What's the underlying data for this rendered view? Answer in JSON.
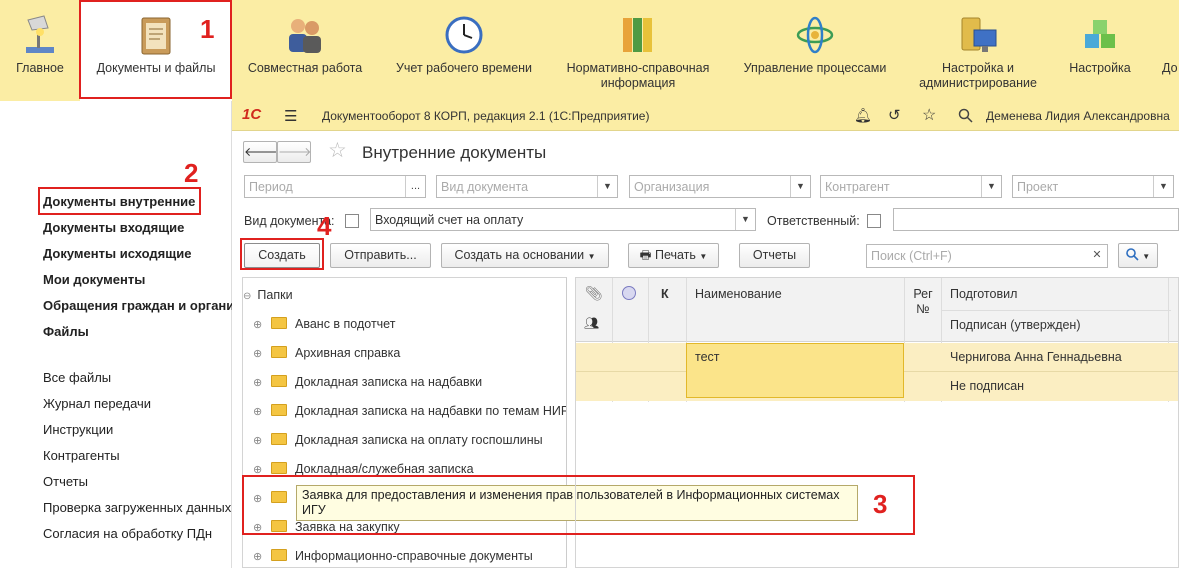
{
  "sections": [
    {
      "label": "Главное",
      "icon": "home-lamp-icon"
    },
    {
      "label": "Документы и файлы",
      "icon": "documents-binder-icon"
    },
    {
      "label": "Совместная работа",
      "icon": "users-collaboration-icon"
    },
    {
      "label": "Учет рабочего времени",
      "icon": "clock-icon"
    },
    {
      "label": "Нормативно-справочная информация",
      "icon": "reference-binders-icon"
    },
    {
      "label": "Управление процессами",
      "icon": "process-atom-icon"
    },
    {
      "label": "Настройка и администрирование",
      "icon": "server-computer-icon"
    },
    {
      "label": "Настройка",
      "icon": "cubes-icon"
    },
    {
      "label": "До",
      "icon": ""
    }
  ],
  "sidebar": {
    "group1": [
      "Документы внутренние",
      "Документы входящие",
      "Документы исходящие",
      "Мои документы",
      "Обращения граждан и организаций",
      "Файлы"
    ],
    "group2": [
      "Все файлы",
      "Журнал передачи",
      "Инструкции",
      "Контрагенты",
      "Отчеты",
      "Проверка загруженных данных",
      "Согласия на обработку ПДн"
    ]
  },
  "window": {
    "logo": "1С",
    "title": "Документооборот 8 КОРП, редакция 2.1  (1С:Предприятие)",
    "user": "Деменева Лидия Александровна",
    "form_title": "Внутренние документы"
  },
  "filters": {
    "period": "Период",
    "doc_kind": "Вид документа",
    "organization": "Организация",
    "counterparty": "Контрагент",
    "project": "Проект",
    "doc_kind_label": "Вид документа:",
    "doc_kind_value": "Входящий счет на оплату",
    "responsible_label": "Ответственный:"
  },
  "toolbar": {
    "create": "Создать",
    "send": "Отправить...",
    "create_based": "Создать на основании",
    "print": "Печать",
    "reports": "Отчеты",
    "search_placeholder": "Поиск (Ctrl+F)"
  },
  "folders": {
    "root": "Папки",
    "items": [
      "Аванс в подотчет",
      "Архивная справка",
      "Докладная записка на надбавки",
      "Докладная записка на надбавки по темам НИР",
      "Докладная записка на оплату госпошлины",
      "Докладная/служебная записка",
      "",
      "Заявка на закупку",
      "Информационно-справочные документы"
    ],
    "tooltip": "Заявка для предоставления и изменения прав пользователей в Информационных системах ИГУ"
  },
  "table": {
    "headers": {
      "k": "К",
      "name": "Наименование",
      "reg": "Рег №",
      "prepared": "Подготовил",
      "signed": "Подписан (утвержден)"
    },
    "rows": [
      {
        "name": "тест",
        "prepared": "Чернигова Анна Геннадьевна",
        "signed": "Не подписан"
      }
    ]
  },
  "annotations": [
    "1",
    "2",
    "3",
    "4"
  ]
}
